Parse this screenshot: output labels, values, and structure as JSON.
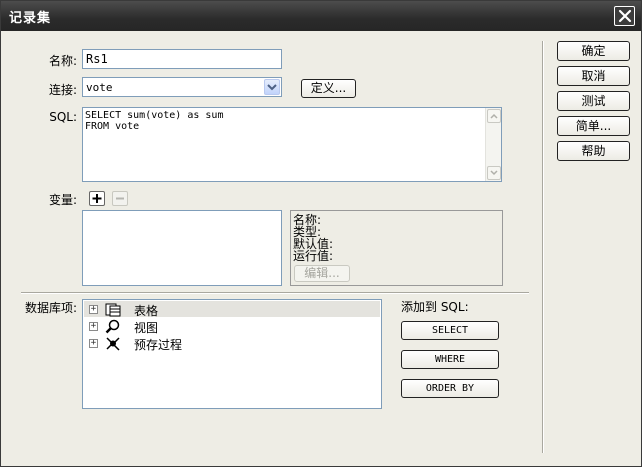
{
  "window": {
    "title": "记录集"
  },
  "form": {
    "name_label": "名称:",
    "name_value": "Rs1",
    "connection_label": "连接:",
    "connection_value": "vote",
    "define_button": "定义...",
    "sql_label": "SQL:",
    "sql_value": "SELECT sum(vote) as sum\nFROM vote",
    "variables_label": "变量:",
    "variable_details": {
      "name_label": "名称:",
      "type_label": "类型:",
      "default_label": "默认值:",
      "runtime_label": "运行值:",
      "edit_button": "编辑..."
    },
    "db_items_label": "数据库项:",
    "db_items": [
      {
        "label": "表格",
        "icon": "table-icon"
      },
      {
        "label": "视图",
        "icon": "view-icon"
      },
      {
        "label": "预存过程",
        "icon": "stored-procedure-icon"
      }
    ],
    "add_to_sql_label": "添加到 SQL:",
    "select_button": "SELECT",
    "where_button": "WHERE",
    "orderby_button": "ORDER BY"
  },
  "side_buttons": {
    "ok": "确定",
    "cancel": "取消",
    "test": "测试",
    "simple": "简单...",
    "help": "帮助"
  }
}
